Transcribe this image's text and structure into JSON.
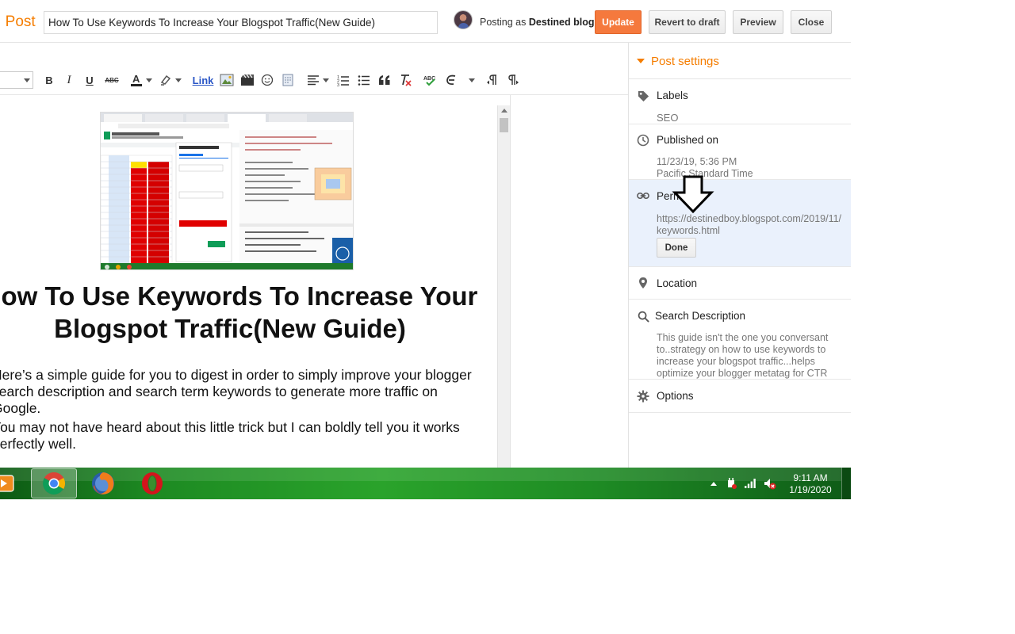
{
  "header": {
    "back_label": "Post",
    "post_title": "How To Use Keywords To Increase Your Blogspot Traffic(New Guide)",
    "posting_as_prefix": "Posting as",
    "blog_name": "Destined blog",
    "update_label": "Update",
    "revert_label": "Revert to draft",
    "preview_label": "Preview",
    "close_label": "Close"
  },
  "toolbar": {
    "bold": "B",
    "italic": "I",
    "underline": "U",
    "strikethrough": "ABC",
    "link": "Link",
    "icons": [
      "bold-icon",
      "italic-icon",
      "underline-icon",
      "strikethrough-icon",
      "text-color-icon",
      "highlight-icon",
      "link",
      "image-icon",
      "video-icon",
      "emoji-icon",
      "jump-break-icon",
      "align-icon",
      "numbered-list-icon",
      "bulleted-list-icon",
      "quote-icon",
      "clear-format-icon",
      "spellcheck-icon",
      "input-tools-icon",
      "ltr-icon",
      "rtl-icon"
    ]
  },
  "content": {
    "heading": "How To Use Keywords To Increase Your Blogspot Traffic(New Guide)",
    "paragraph_1": "Here’s a simple guide for you to digest in order to simply improve your blogger search description and search term keywords to generate more traffic on Google.",
    "paragraph_2": "You may not have heard about this little trick but I can boldly tell you it works perfectly well."
  },
  "post_settings": {
    "title": "Post settings",
    "labels": {
      "title": "Labels",
      "value": "SEO"
    },
    "published": {
      "title": "Published on",
      "date": "11/23/19, 5:36 PM",
      "timezone": "Pacific Standard Time"
    },
    "permalink": {
      "title": "Permalink",
      "url": "https://destinedboy.blogspot.com/2019/11/keywords.html",
      "done_label": "Done"
    },
    "location": {
      "title": "Location"
    },
    "search_description": {
      "title": "Search Description",
      "value": "This guide isn't the one you conversant to..strategy on how to use keywords to increase your blogspot traffic...helps optimize your blogger metatag for CTR"
    },
    "options": {
      "title": "Options"
    }
  },
  "taskbar": {
    "apps": [
      "media-player",
      "chrome",
      "firefox",
      "opera"
    ],
    "time": "9:11 AM",
    "date": "1/19/2020"
  },
  "colors": {
    "accent": "#f57d00",
    "update_button": "#f5793d",
    "link_blue": "#2a56c6",
    "permalink_bg": "#eaf1fc",
    "taskbar_green": "#2aa32b"
  }
}
